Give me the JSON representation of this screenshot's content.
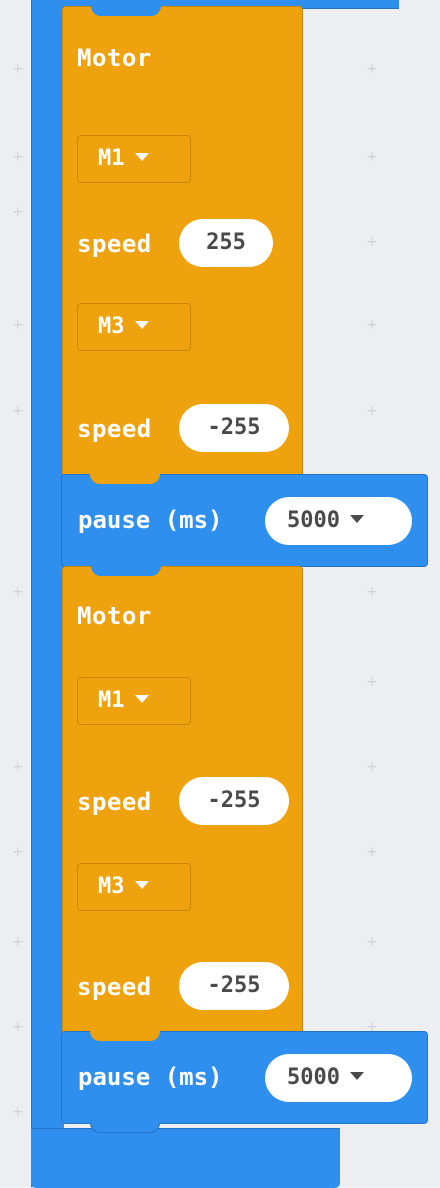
{
  "motor_blocks": [
    {
      "label": "Motor",
      "motor_a": "M1",
      "speed_label_a": "speed",
      "speed_a": "255",
      "motor_b": "M3",
      "speed_label_b": "speed",
      "speed_b": "-255"
    },
    {
      "label": "Motor",
      "motor_a": "M1",
      "speed_label_a": "speed",
      "speed_a": "-255",
      "motor_b": "M3",
      "speed_label_b": "speed",
      "speed_b": "-255"
    }
  ],
  "pause_blocks": [
    {
      "label": "pause (ms)",
      "value": "5000"
    },
    {
      "label": "pause (ms)",
      "value": "5000"
    }
  ],
  "colors": {
    "motor_block": "#eea20d",
    "control_block": "#2e8fee",
    "workspace": "#eceef1",
    "field_bg": "#ffffff"
  }
}
